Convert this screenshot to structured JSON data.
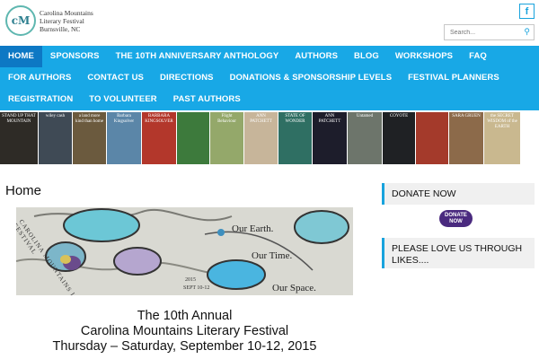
{
  "logo": {
    "mark": "cM",
    "line1": "Carolina Mountains",
    "line2": "Literary Festival",
    "line3": "Burnsville, NC"
  },
  "header": {
    "facebook_icon": "f",
    "search_placeholder": "Search..."
  },
  "nav": {
    "row1": [
      "HOME",
      "SPONSORS",
      "THE 10TH ANNIVERSARY ANTHOLOGY",
      "AUTHORS",
      "BLOG",
      "WORKSHOPS",
      "FAQ"
    ],
    "row2": [
      "FOR AUTHORS",
      "CONTACT US",
      "DIRECTIONS",
      "DONATIONS & SPONSORSHIP LEVELS",
      "FESTIVAL PLANNERS"
    ],
    "row3": [
      "REGISTRATION",
      "TO VOLUNTEER",
      "PAST AUTHORS"
    ]
  },
  "books": [
    {
      "text": "STAND UP THAT MOUNTAIN",
      "bg": "#2e2b26",
      "w": 42
    },
    {
      "text": "wiley cash",
      "bg": "#3f4a55",
      "w": 37
    },
    {
      "text": "a land more kind than home",
      "bg": "#6b5a3e",
      "w": 37
    },
    {
      "text": "Barbara Kingsolver",
      "bg": "#5b86a8",
      "w": 38
    },
    {
      "text": "BARBARA KINGSOLVER",
      "bg": "#b3372b",
      "w": 38
    },
    {
      "text": "",
      "bg": "#3d7a3c",
      "w": 36
    },
    {
      "text": "Flight Behaviour",
      "bg": "#94a86a",
      "w": 37
    },
    {
      "text": "ANN PATCHETT",
      "bg": "#c7b59a",
      "w": 37
    },
    {
      "text": "STATE OF WONDER",
      "bg": "#2f6f63",
      "w": 37
    },
    {
      "text": "ANN PATCHETT",
      "bg": "#1d1d2b",
      "w": 38
    },
    {
      "text": "Untamed",
      "bg": "#6d756b",
      "w": 38
    },
    {
      "text": "COYOTE",
      "bg": "#1f2124",
      "w": 36
    },
    {
      "text": "",
      "bg": "#a43a2b",
      "w": 36
    },
    {
      "text": "SARA GRUEN",
      "bg": "#8c6a4a",
      "w": 38
    },
    {
      "text": "the SECRET WISDOM of the EARTH",
      "bg": "#c9b88f",
      "w": 40
    }
  ],
  "page_title": "Home",
  "banner": {
    "title": "CAROLINA MOUNTAINS LITERARY FESTIVAL",
    "year": "2015",
    "dates": "SEPT 10-12",
    "line1": "Our Earth.",
    "line2": "Our Time.",
    "line3": "Our Space."
  },
  "main": {
    "line1": "The 10th Annual",
    "line2": "Carolina Mountains Literary Festival",
    "line3": "Thursday – Saturday, September 10-12, 2015"
  },
  "sidebar": {
    "donate_title": "DONATE NOW",
    "donate_button": "DONATE NOW",
    "likes_title": "PLEASE LOVE US THROUGH LIKES...."
  }
}
